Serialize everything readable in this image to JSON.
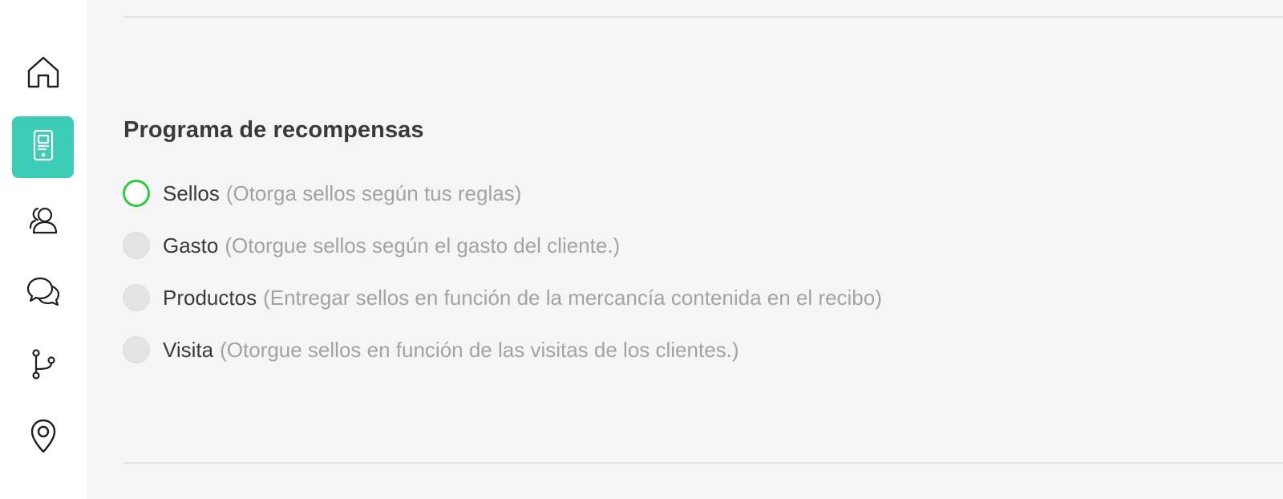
{
  "sidebar": {
    "items": [
      {
        "icon": "home-icon",
        "active": false
      },
      {
        "icon": "card-device-icon",
        "active": true
      },
      {
        "icon": "users-icon",
        "active": false
      },
      {
        "icon": "chat-bubbles-icon",
        "active": false
      },
      {
        "icon": "branch-icon",
        "active": false
      },
      {
        "icon": "location-pin-icon",
        "active": false
      }
    ],
    "active_color": "#3dccb6"
  },
  "main": {
    "section_title": "Programa de recompensas",
    "options": [
      {
        "label": "Sellos",
        "description": "(Otorga sellos según tus reglas)",
        "selected": true
      },
      {
        "label": "Gasto",
        "description": "(Otorgue sellos según el gasto del cliente.)",
        "selected": false
      },
      {
        "label": "Productos",
        "description": "(Entregar sellos en función de la mercancía contenida en el recibo)",
        "selected": false
      },
      {
        "label": "Visita",
        "description": "(Otorgue sellos en función de las visitas de los clientes.)",
        "selected": false
      }
    ],
    "selected_color": "#2ecc40"
  }
}
